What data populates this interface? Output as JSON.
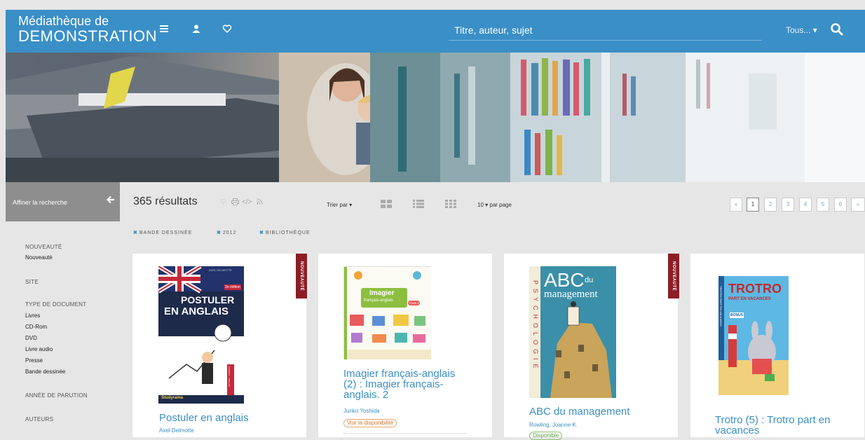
{
  "header": {
    "brand_line1": "Médiathèque de",
    "brand_line2": "DEMONSTRATION",
    "search_placeholder": "Titre, auteur, sujet",
    "scope_label": "Tous...",
    "icons": [
      "menu-icon",
      "user-icon",
      "heart-icon",
      "search-icon"
    ]
  },
  "sidebar": {
    "refine_label": "Affiner la recherche",
    "facets": [
      {
        "title": "NOUVEAUTÉ",
        "items": [
          "Nouveauté"
        ]
      },
      {
        "title": "SITE",
        "items": []
      },
      {
        "title": "TYPE DE DOCUMENT",
        "items": [
          "Livres",
          "CD-Rom",
          "DVD",
          "Livre audio",
          "Presse",
          "Bande dessinée"
        ]
      },
      {
        "title": "ANNÉE DE PARUTION",
        "items": []
      },
      {
        "title": "AUTEURS",
        "items": []
      }
    ]
  },
  "results": {
    "count_label": "365 résultats",
    "sort_label": "Trier par",
    "per_page_label": "10",
    "per_page_suffix": "par page",
    "pages": [
      "«",
      "1",
      "2",
      "3",
      "4",
      "5",
      "6",
      "»"
    ],
    "active_page": "1",
    "active_filters": [
      "BANDE DESSINÉE",
      "2012",
      "BIBLIOTHÈQUE"
    ]
  },
  "cards": [
    {
      "title": "Postuler en anglais",
      "author": "Axel Delmotte",
      "ribbon": "NOUVEAUTÉ",
      "cover": {
        "top_text": "AXEL DELMOTTE",
        "title1": "POSTULER",
        "title2": "EN ANGLAIS",
        "edition": "2e édition",
        "publisher": "Studyrama",
        "side": "LANGUES · ANGLAIS"
      }
    },
    {
      "title": "Imagier français-anglais (2) : Imagier français-anglais. 2",
      "author": "Junko Yoshida",
      "availability": "Voir la disponibilité",
      "cover": {
        "title": "Imagier",
        "subtitle": "français-anglais",
        "tome": "TOME 2"
      }
    },
    {
      "title": "ABC du management",
      "author": "Rowling, Joanne K.",
      "ribbon": "NOUVEAUTÉ",
      "availability": "Disponible",
      "cover": {
        "title1": "ABC",
        "title1b": "du",
        "title2": "management",
        "side": "PSYCHOLOGIE"
      }
    },
    {
      "title": "Trotro (5) : Trotro part en vacances",
      "cover": {
        "title": "TROTRO",
        "subtitle": "PART EN VACANCES",
        "badge": "BONUS",
        "side": "TROTRO PART EN VACANCES"
      }
    }
  ],
  "colors": {
    "header": "#3a8fc7",
    "ribbon": "#8b1d26",
    "link": "#3a8fc7",
    "availability": "#c9782e"
  }
}
